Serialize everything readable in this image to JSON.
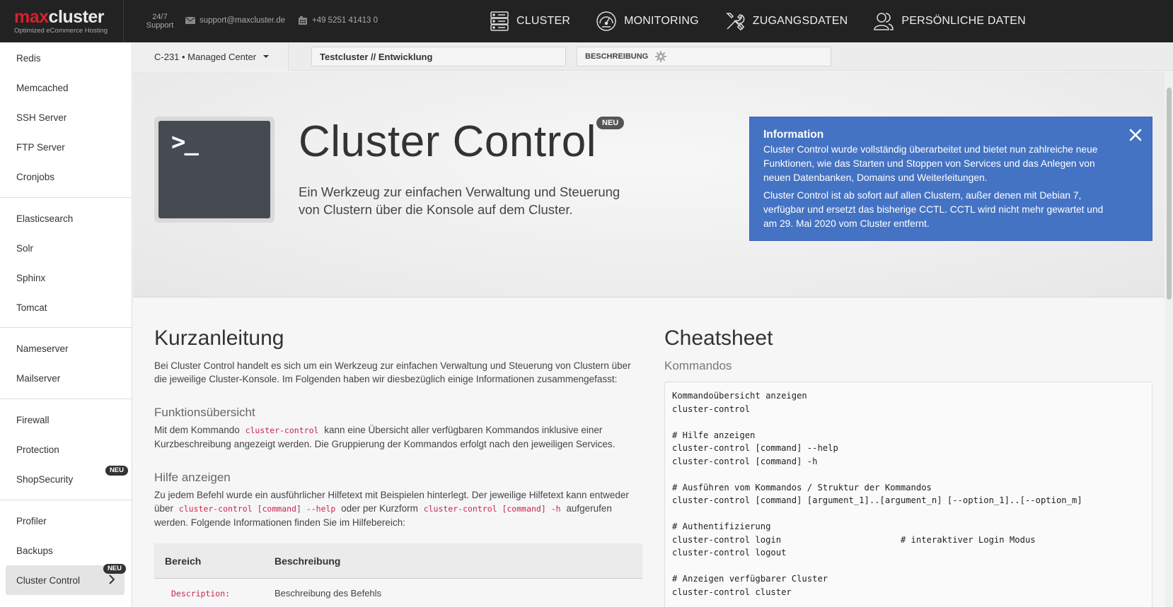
{
  "topbar": {
    "logo_max": "max",
    "logo_cluster": "cluster",
    "logo_tagline": "Optimized eCommerce Hosting",
    "support_line1": "24/7",
    "support_line2": "Support",
    "email": "support@maxcluster.de",
    "phone": "+49 5251 41413 0",
    "nav": [
      {
        "label": "CLUSTER",
        "icon": "server-icon"
      },
      {
        "label": "MONITORING",
        "icon": "speedometer-icon"
      },
      {
        "label": "ZUGANGSDATEN",
        "icon": "tools-icon"
      },
      {
        "label": "PERSÖNLICHE DATEN",
        "icon": "users-icon"
      }
    ]
  },
  "sidebar": {
    "items": [
      {
        "label": "Redis"
      },
      {
        "label": "Memcached"
      },
      {
        "label": "SSH Server"
      },
      {
        "label": "FTP Server"
      },
      {
        "label": "Cronjobs"
      },
      {
        "label": "Elasticsearch"
      },
      {
        "label": "Solr"
      },
      {
        "label": "Sphinx"
      },
      {
        "label": "Tomcat"
      },
      {
        "label": "Nameserver"
      },
      {
        "label": "Mailserver"
      },
      {
        "label": "Firewall"
      },
      {
        "label": "Protection"
      },
      {
        "label": "ShopSecurity",
        "badge": "NEU"
      },
      {
        "label": "Profiler"
      },
      {
        "label": "Backups"
      },
      {
        "label": "Cluster Control",
        "badge": "NEU",
        "active": true
      }
    ]
  },
  "subheader": {
    "cluster_selector": "C-231 • Managed Center",
    "cluster_name": "Testcluster // Entwicklung",
    "description_label": "BESCHREIBUNG"
  },
  "hero": {
    "prompt": ">_",
    "title": "Cluster Control",
    "badge": "NEU",
    "subtitle": "Ein Werkzeug zur einfachen Verwaltung und Steuerung von Clustern über die Konsole auf dem Cluster."
  },
  "info": {
    "title": "Information",
    "text1": "Cluster Control wurde vollständig überarbeitet und bietet nun zahlreiche neue Funktionen, wie das Starten und Stoppen von Services und das Anlegen von neuen Datenbanken, Domains und Weiterleitungen.",
    "text2": "Cluster Control ist ab sofort auf allen Clustern, außer denen mit Debian 7, verfügbar und ersetzt das bisherige CCTL. CCTL wird nicht mehr gewartet und am 29. Mai 2020 vom Cluster entfernt."
  },
  "kurzanleitung": {
    "title": "Kurzanleitung",
    "intro": "Bei Cluster Control handelt es sich um ein Werkzeug zur einfachen Verwaltung und Steuerung von Clustern über die jeweilige Cluster-Konsole. Im Folgenden haben wir diesbezüglich einige Informationen zusammengefasst:",
    "func_title": "Funktionsübersicht",
    "func_pre": "Mit dem Kommando",
    "func_code": "cluster-control",
    "func_post": "kann eine Übersicht aller verfügbaren Kommandos inklusive einer Kurzbeschreibung angezeigt werden. Die Gruppierung der Kommandos erfolgt nach den jeweiligen Services.",
    "help_title": "Hilfe anzeigen",
    "help_pre": "Zu jedem Befehl wurde ein ausführlicher Hilfetext mit Beispielen hinterlegt. Der jeweilige Hilfetext kann entweder über",
    "help_code1": "cluster-control [command] --help",
    "help_mid": "oder per Kurzform",
    "help_code2": "cluster-control [command] -h",
    "help_post": "aufgerufen werden. Folgende Informationen finden Sie im Hilfebereich:",
    "table_header_area": "Bereich",
    "table_header_desc": "Beschreibung",
    "table_row1_area": "Description:",
    "table_row1_desc": "Beschreibung des Befehls"
  },
  "cheatsheet": {
    "title": "Cheatsheet",
    "subtitle": "Kommandos",
    "code": "Kommandoübersicht anzeigen\ncluster-control\n\n# Hilfe anzeigen\ncluster-control [command] --help\ncluster-control [command] -h\n\n# Ausführen vom Kommandos / Struktur der Kommandos\ncluster-control [command] [argument_1]..[argument_n] [--option_1]..[--option_m]\n\n# Authentifizierung\ncluster-control login                       # interaktiver Login Modus\ncluster-control logout\n\n# Anzeigen verfügbarer Cluster\ncluster-control cluster"
  }
}
